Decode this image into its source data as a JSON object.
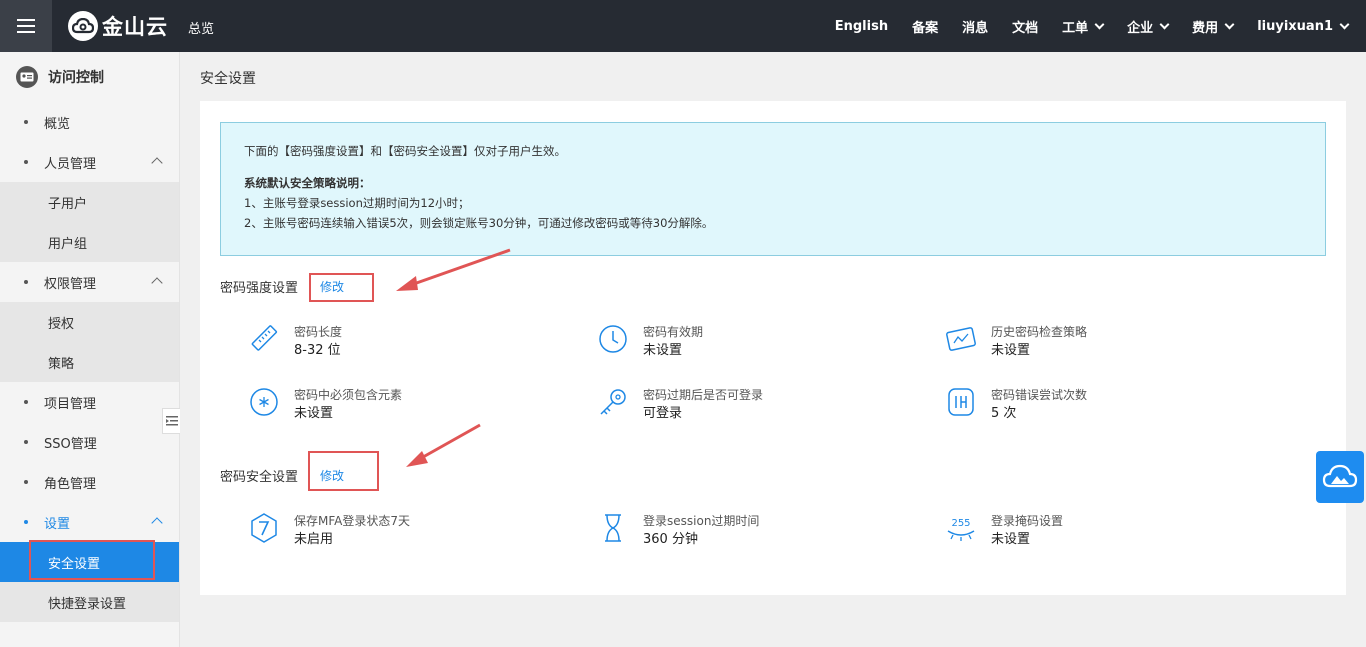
{
  "header": {
    "logo_text": "金山云",
    "overview": "总览",
    "nav": {
      "english": "English",
      "beian": "备案",
      "messages": "消息",
      "docs": "文档",
      "tickets": "工单",
      "enterprise": "企业",
      "billing": "费用",
      "user": "liuyixuan1"
    }
  },
  "sidebar": {
    "title": "访问控制",
    "items": {
      "overview": "概览",
      "people": "人员管理",
      "subusers": "子用户",
      "usergroups": "用户组",
      "perm": "权限管理",
      "grant": "授权",
      "policy": "策略",
      "project": "项目管理",
      "sso": "SSO管理",
      "role": "角色管理",
      "settings": "设置",
      "security": "安全设置",
      "quicklogin": "快捷登录设置"
    }
  },
  "main": {
    "title": "安全设置",
    "notice": {
      "line1": "下面的【密码强度设置】和【密码安全设置】仅对子用户生效。",
      "title": "系统默认安全策略说明：",
      "item1": "1、主账号登录session过期时间为12小时；",
      "item2": "2、主账号密码连续输入错误5次，则会锁定账号30分钟，可通过修改密码或等待30分解除。"
    },
    "strength": {
      "title": "密码强度设置",
      "edit": "修改",
      "length_label": "密码长度",
      "length_value": "8-32 位",
      "validity_label": "密码有效期",
      "validity_value": "未设置",
      "history_label": "历史密码检查策略",
      "history_value": "未设置",
      "elements_label": "密码中必须包含元素",
      "elements_value": "未设置",
      "expired_label": "密码过期后是否可登录",
      "expired_value": "可登录",
      "retry_label": "密码错误尝试次数",
      "retry_value": "5 次"
    },
    "security": {
      "title": "密码安全设置",
      "edit": "修改",
      "mfa_label": "保存MFA登录状态7天",
      "mfa_value": "未启用",
      "session_label": "登录session过期时间",
      "session_value": "360 分钟",
      "mask_label": "登录掩码设置",
      "mask_value": "未设置"
    }
  },
  "colors": {
    "accent": "#1e88e5",
    "topbar": "#262b33",
    "highlight": "#e05555",
    "notice_bg": "#e0f7fc"
  }
}
